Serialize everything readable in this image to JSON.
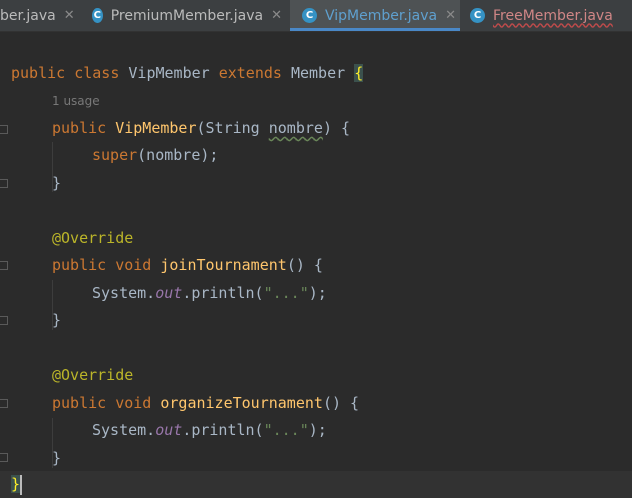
{
  "tabs": [
    {
      "label": "ber.java",
      "icon": "none",
      "state": "normal"
    },
    {
      "label": "PremiumMember.java",
      "icon": "class-icon",
      "state": "normal"
    },
    {
      "label": "VipMember.java",
      "icon": "class-icon",
      "state": "active"
    },
    {
      "label": "FreeMember.java",
      "icon": "class-icon",
      "state": "error"
    }
  ],
  "tab_close_glyph": "✕",
  "class_icon_glyph": "C",
  "usage_hint": "1 usage",
  "code": {
    "l1_public": "public",
    "l1_class": "class",
    "l1_name": "VipMember",
    "l1_extends": "extends",
    "l1_super": "Member",
    "l1_brace": "{",
    "l2_public": "public",
    "l2_ctor": "VipMember",
    "l2_open": "(String ",
    "l2_param": "nombre",
    "l2_close": ") {",
    "l3_super": "super",
    "l3_rest": "(nombre);",
    "close_brace": "}",
    "override": "@Override",
    "l6_public": "public",
    "l6_void": "void",
    "l6_name": "joinTournament",
    "l6_rest": "() {",
    "println_pre": "System.",
    "println_out": "out",
    "println_mid": ".println(",
    "println_str": "\"...\"",
    "println_end": ");",
    "l10_public": "public",
    "l10_void": "void",
    "l10_name": "organizeTournament",
    "l10_rest": "() {",
    "last_brace": "}"
  },
  "colors": {
    "keyword": "#cc7832",
    "method": "#ffc66d",
    "annotation": "#bbb529",
    "string": "#6a8759",
    "field": "#9876aa",
    "text": "#a9b7c6",
    "background": "#2b2b2b"
  }
}
